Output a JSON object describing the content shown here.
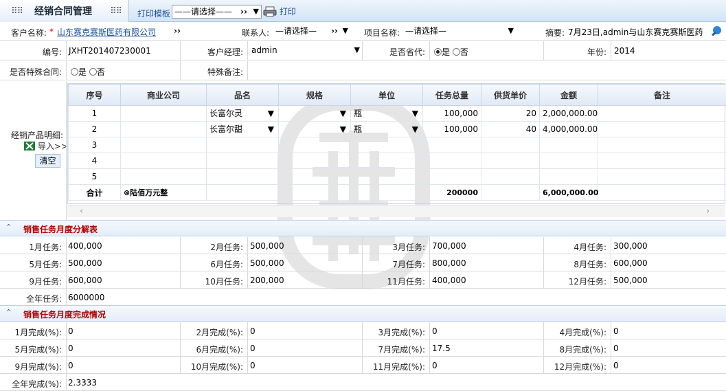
{
  "page": {
    "title": "经销合同管理"
  },
  "toolbar": {
    "print_template_label": "打印模板",
    "print_template_value": "——请选择——",
    "print_label": "打印"
  },
  "header": {
    "customer_label": "客户名称:",
    "customer_required": "*",
    "customer_value": "山东赛克赛斯医药有限公司",
    "contact_label": "联系人:",
    "contact_value": "—请选择—",
    "project_label": "项目名称:",
    "project_value": "—请选择—",
    "summary_label": "摘要:",
    "summary_value": "7月23日,admin与山东赛克赛斯医药"
  },
  "form": {
    "number_label": "编号:",
    "number_value": "JXHT201407230001",
    "manager_label": "客户经理:",
    "manager_value": "admin",
    "agent_label": "是否省代:",
    "yes": "是",
    "no": "否",
    "year_label": "年份:",
    "year_value": "2014",
    "special_label": "是否特殊合同:",
    "special_note_label": "特殊备注:",
    "products_label": "经销产品明细:",
    "import_label": "导入>>",
    "clear_label": "清空"
  },
  "grid": {
    "headers": [
      "序号",
      "商业公司",
      "品名",
      "规格",
      "单位",
      "任务总量",
      "供货单价",
      "金额",
      "备注"
    ],
    "rows": [
      {
        "no": "1",
        "company": "",
        "name": "长富尔灵",
        "spec": "",
        "unit": "瓶",
        "qty": "100,000",
        "price": "20",
        "amount": "2,000,000.00",
        "note": ""
      },
      {
        "no": "2",
        "company": "",
        "name": "长富尔甜",
        "spec": "",
        "unit": "瓶",
        "qty": "100,000",
        "price": "40",
        "amount": "4,000,000.00",
        "note": ""
      },
      {
        "no": "3",
        "company": "",
        "name": "",
        "spec": "",
        "unit": "",
        "qty": "",
        "price": "",
        "amount": "",
        "note": ""
      },
      {
        "no": "4",
        "company": "",
        "name": "",
        "spec": "",
        "unit": "",
        "qty": "",
        "price": "",
        "amount": "",
        "note": ""
      },
      {
        "no": "5",
        "company": "",
        "name": "",
        "spec": "",
        "unit": "",
        "qty": "",
        "price": "",
        "amount": "",
        "note": ""
      }
    ],
    "total": {
      "label": "合计",
      "words": "⊗陆佰万元整",
      "qty": "200000",
      "amount": "6,000,000.00"
    }
  },
  "monthly_task": {
    "title": "销售任务月度分解表",
    "items": [
      {
        "label": "1月任务:",
        "value": "400,000"
      },
      {
        "label": "2月任务:",
        "value": "500,000"
      },
      {
        "label": "3月任务:",
        "value": "700,000"
      },
      {
        "label": "4月任务:",
        "value": "300,000"
      },
      {
        "label": "5月任务:",
        "value": "500,000"
      },
      {
        "label": "6月任务:",
        "value": "500,000"
      },
      {
        "label": "7月任务:",
        "value": "800,000"
      },
      {
        "label": "8月任务:",
        "value": "600,000"
      },
      {
        "label": "9月任务:",
        "value": "600,000"
      },
      {
        "label": "10月任务:",
        "value": "200,000"
      },
      {
        "label": "11月任务:",
        "value": "400,000"
      },
      {
        "label": "12月任务:",
        "value": "500,000"
      }
    ],
    "annual_label": "全年任务:",
    "annual_value": "6000000"
  },
  "monthly_done": {
    "title": "销售任务月度完成情况",
    "items": [
      {
        "label": "1月完成(%):",
        "value": "0"
      },
      {
        "label": "2月完成(%):",
        "value": "0"
      },
      {
        "label": "3月完成(%):",
        "value": "0"
      },
      {
        "label": "4月完成(%):",
        "value": "0"
      },
      {
        "label": "5月完成(%):",
        "value": "0"
      },
      {
        "label": "6月完成(%):",
        "value": "0"
      },
      {
        "label": "7月完成(%):",
        "value": "17.5"
      },
      {
        "label": "8月完成(%):",
        "value": "0"
      },
      {
        "label": "9月完成(%):",
        "value": "0"
      },
      {
        "label": "10月完成(%):",
        "value": "0"
      },
      {
        "label": "11月完成(%):",
        "value": "0"
      },
      {
        "label": "12月完成(%):",
        "value": "0"
      }
    ],
    "annual_label": "全年完成(%):",
    "annual_value": "2.3333"
  },
  "icons": {
    "print": "printer-icon",
    "excel": "excel-icon",
    "search": "search-icon"
  }
}
